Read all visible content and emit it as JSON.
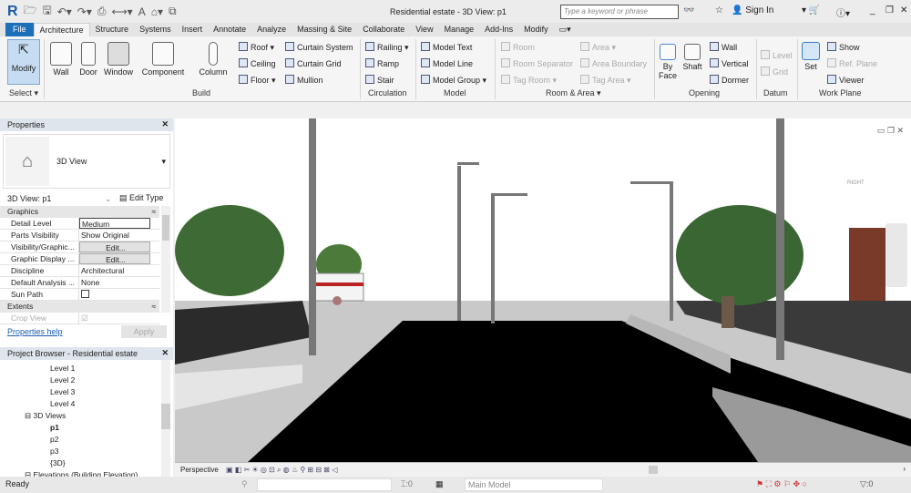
{
  "titlebar": {
    "title": "Residential estate - 3D View: p1",
    "search_placeholder": "Type a keyword or phrase",
    "sign_in": "Sign In"
  },
  "tabs": [
    "File",
    "Architecture",
    "Structure",
    "Systems",
    "Insert",
    "Annotate",
    "Analyze",
    "Massing & Site",
    "Collaborate",
    "View",
    "Manage",
    "Add-Ins",
    "Modify"
  ],
  "ribbon": {
    "select": {
      "modify": "Modify",
      "group": "Select ▾"
    },
    "build": {
      "wall": "Wall",
      "door": "Door",
      "window": "Window",
      "component": "Component",
      "column": "Column",
      "roof": "Roof ▾",
      "ceiling": "Ceiling",
      "floor": "Floor ▾",
      "curtain_system": "Curtain System",
      "curtain_grid": "Curtain Grid",
      "mullion": "Mullion",
      "group": "Build"
    },
    "circulation": {
      "railing": "Railing ▾",
      "ramp": "Ramp",
      "stair": "Stair",
      "group": "Circulation"
    },
    "model": {
      "text": "Model Text",
      "line": "Model Line",
      "group_btn": "Model Group ▾",
      "group": "Model"
    },
    "room_area": {
      "room": "Room",
      "room_separator": "Room Separator",
      "tag_room": "Tag Room ▾",
      "area": "Area ▾",
      "area_boundary": "Area Boundary",
      "tag_area": "Tag Area ▾",
      "group": "Room & Area ▾"
    },
    "opening": {
      "by_face": "By Face",
      "shaft": "Shaft",
      "wall": "Wall",
      "vertical": "Vertical",
      "dormer": "Dormer",
      "group": "Opening"
    },
    "datum": {
      "level": "Level",
      "grid": "Grid",
      "group": "Datum"
    },
    "work_plane": {
      "set": "Set",
      "show": "Show",
      "ref_plane": "Ref. Plane",
      "viewer": "Viewer",
      "group": "Work Plane"
    }
  },
  "properties": {
    "title": "Properties",
    "type_name": "3D View",
    "instance": "3D View: p1",
    "edit_type": "Edit Type",
    "graphics": "Graphics",
    "rows": [
      {
        "k": "Detail Level",
        "v": "Medium"
      },
      {
        "k": "Parts Visibility",
        "v": "Show Original"
      },
      {
        "k": "Visibility/Graphic...",
        "v": "Edit..."
      },
      {
        "k": "Graphic Display ...",
        "v": "Edit..."
      },
      {
        "k": "Discipline",
        "v": "Architectural"
      },
      {
        "k": "Default Analysis ...",
        "v": "None"
      },
      {
        "k": "Sun Path",
        "v": ""
      }
    ],
    "extents": "Extents",
    "crop_view": "Crop View",
    "help": "Properties help",
    "apply": "Apply"
  },
  "browser": {
    "title": "Project Browser - Residential estate",
    "items": [
      "Level 1",
      "Level 2",
      "Level 3",
      "Level 4",
      "3D Views",
      "p1",
      "p2",
      "p3",
      "{3D}",
      "Elevations (Building Elevation)"
    ]
  },
  "view": {
    "mode": "Perspective",
    "cube_label": "RIGHT"
  },
  "status": {
    "text": "Ready",
    "count1": ":0",
    "model": "Main Model",
    "filter": ":0"
  }
}
